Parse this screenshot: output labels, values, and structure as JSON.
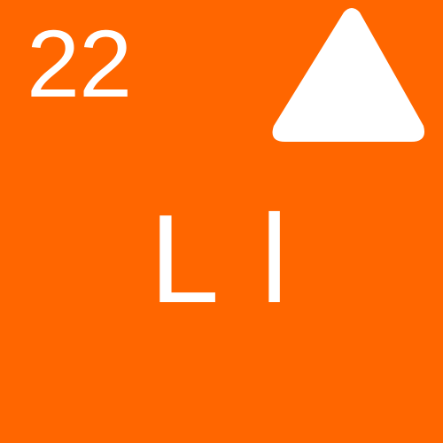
{
  "tile": {
    "background_color": "#ff6600",
    "foreground_color": "#ffffff",
    "number": "22",
    "letters": "L l",
    "icon": "triangle-up-icon"
  }
}
